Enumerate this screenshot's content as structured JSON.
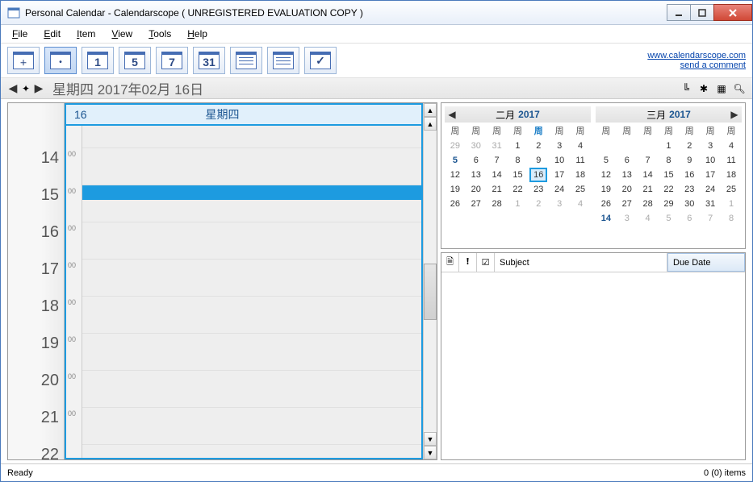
{
  "title": "Personal Calendar - Calendarscope ( UNREGISTERED EVALUATION COPY )",
  "menu": {
    "file": "File",
    "edit": "Edit",
    "item": "Item",
    "view": "View",
    "tools": "Tools",
    "help": "Help"
  },
  "toolbar": {
    "btn1": "1",
    "btn5": "5",
    "btn7": "7",
    "btn31": "31"
  },
  "links": {
    "site": "www.calendarscope.com",
    "comment": "send a comment"
  },
  "nav": {
    "title": "星期四 2017年02月 16日"
  },
  "day": {
    "num": "16",
    "name": "星期四"
  },
  "hours": [
    "14",
    "15",
    "16",
    "17",
    "18",
    "19",
    "20",
    "21",
    "22"
  ],
  "min00": "00",
  "month1": {
    "title": "二月",
    "year": "2017",
    "wd": [
      "周",
      "周",
      "周",
      "周",
      "周",
      "周",
      "周"
    ],
    "rows": [
      [
        "29",
        "30",
        "31",
        "1",
        "2",
        "3",
        "4"
      ],
      [
        "5",
        "6",
        "7",
        "8",
        "9",
        "10",
        "11"
      ],
      [
        "12",
        "13",
        "14",
        "15",
        "16",
        "17",
        "18"
      ],
      [
        "19",
        "20",
        "21",
        "22",
        "23",
        "24",
        "25"
      ],
      [
        "26",
        "27",
        "28",
        "1",
        "2",
        "3",
        "4"
      ],
      [
        "",
        "",
        "",
        "",
        "",
        "",
        ""
      ]
    ]
  },
  "month2": {
    "title": "三月",
    "year": "2017",
    "wd": [
      "周",
      "周",
      "周",
      "周",
      "周",
      "周",
      "周"
    ],
    "rows": [
      [
        "",
        "",
        "",
        "1",
        "2",
        "3",
        "4"
      ],
      [
        "5",
        "6",
        "7",
        "8",
        "9",
        "10",
        "11"
      ],
      [
        "12",
        "13",
        "14",
        "15",
        "16",
        "17",
        "18"
      ],
      [
        "19",
        "20",
        "21",
        "22",
        "23",
        "24",
        "25"
      ],
      [
        "26",
        "27",
        "28",
        "29",
        "30",
        "31",
        "1"
      ],
      [
        "14",
        "3",
        "4",
        "5",
        "6",
        "7",
        "8"
      ]
    ]
  },
  "tasks": {
    "subject": "Subject",
    "due": "Due Date"
  },
  "status": {
    "left": "Ready",
    "right": "0 (0) items"
  }
}
